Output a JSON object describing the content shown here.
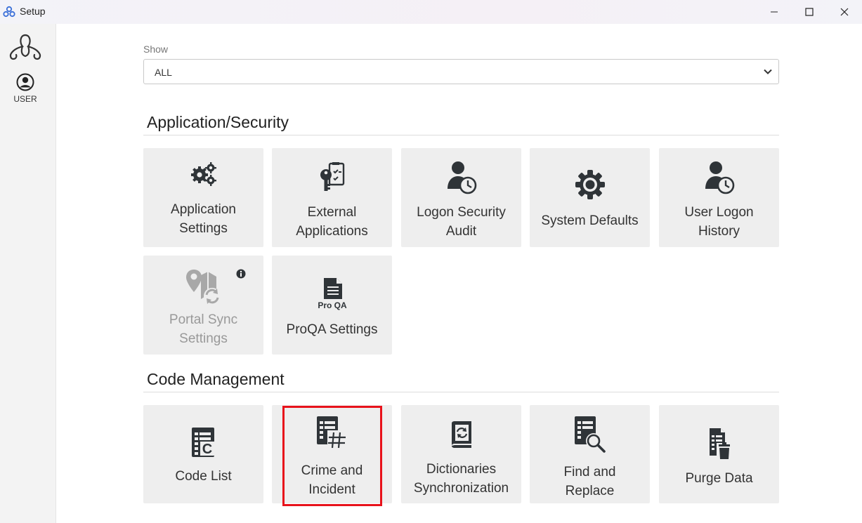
{
  "window": {
    "title": "Setup"
  },
  "sidebar": {
    "user_label": "USER"
  },
  "filter": {
    "label": "Show",
    "selected": "ALL"
  },
  "sections": {
    "app_security": {
      "title": "Application/Security",
      "tiles": {
        "application_settings": {
          "line1": "Application",
          "line2": "Settings",
          "icon": "gears-icon"
        },
        "external_applications": {
          "line1": "External",
          "line2": "Applications",
          "icon": "key-checklist-icon"
        },
        "logon_security_audit": {
          "line1": "Logon Security",
          "line2": "Audit",
          "icon": "user-clock-icon"
        },
        "system_defaults": {
          "line1": "System Defaults",
          "icon": "gear-icon"
        },
        "user_logon_history": {
          "line1": "User Logon",
          "line2": "History",
          "icon": "user-clock-icon"
        },
        "portal_sync_settings": {
          "line1": "Portal Sync",
          "line2": "Settings",
          "icon": "map-sync-icon",
          "state": "disabled"
        },
        "proqa_settings": {
          "line1": "ProQA Settings",
          "icon": "proqa-document-icon",
          "icon_text": "Pro QA"
        }
      }
    },
    "code_management": {
      "title": "Code Management",
      "tiles": {
        "code_list": {
          "line1": "Code List",
          "icon": "code-list-icon"
        },
        "crime_incident": {
          "line1": "Crime and",
          "line2": "Incident",
          "icon": "document-hash-icon"
        },
        "dictionaries_sync": {
          "line1": "Dictionaries",
          "line2": "Synchronization",
          "icon": "book-sync-icon"
        },
        "find_replace": {
          "line1": "Find and",
          "line2": "Replace",
          "icon": "document-search-icon"
        },
        "purge_data": {
          "line1": "Purge Data",
          "icon": "document-trash-icon"
        }
      }
    }
  },
  "colors": {
    "tile_bg": "#eeeeee",
    "icon": "#2f3438",
    "highlight": "#e8121b",
    "disabled_text": "#999999"
  }
}
